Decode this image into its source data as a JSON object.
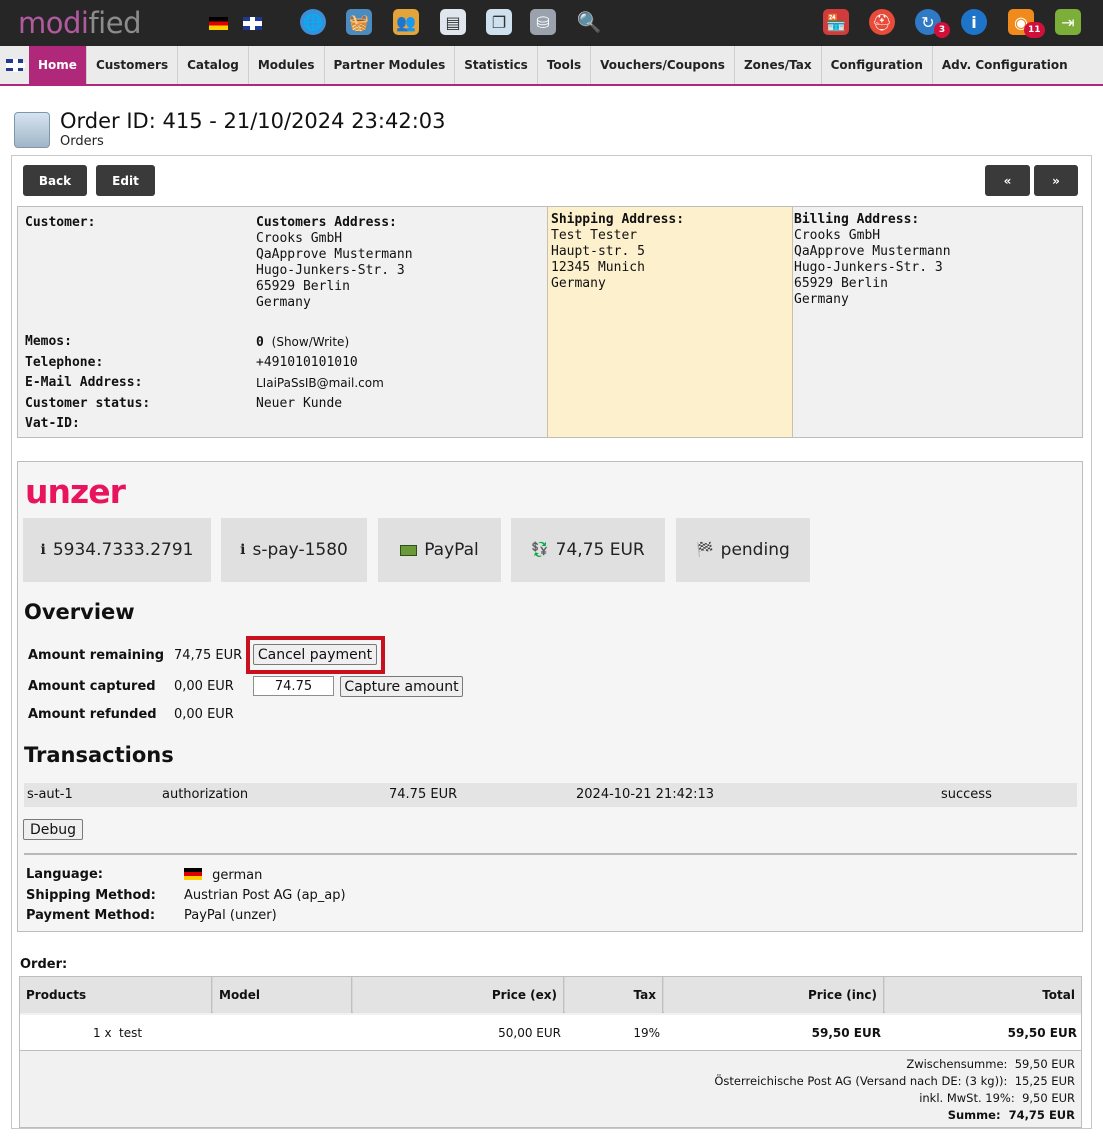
{
  "app": {
    "logo_prefix": "modi",
    "logo_suffix": "fied"
  },
  "topbar": {
    "badges": {
      "updates": "3",
      "news": "11"
    }
  },
  "nav": {
    "items": [
      "Home",
      "Customers",
      "Catalog",
      "Modules",
      "Partner Modules",
      "Statistics",
      "Tools",
      "Vouchers/Coupons",
      "Zones/Tax",
      "Configuration",
      "Adv. Configuration"
    ]
  },
  "header": {
    "title": "Order ID: 415 - 21/10/2024 23:42:03",
    "subtitle": "Orders"
  },
  "buttons": {
    "back": "Back",
    "edit": "Edit",
    "prev": "«",
    "next": "»"
  },
  "customer": {
    "customer_label": "Customer:",
    "address_label": "Customers Address:",
    "address_lines": [
      "Crooks GmbH",
      "QaApprove Mustermann",
      "Hugo-Junkers-Str. 3",
      "65929 Berlin",
      "Germany"
    ],
    "memos_label": "Memos:",
    "memos_count": "0",
    "memos_link": "(Show/Write)",
    "telephone_label": "Telephone:",
    "telephone": "+491010101010",
    "email_label": "E-Mail Address:",
    "email": "LIaiPaSsIB@mail.com",
    "status_label": "Customer status:",
    "status": "Neuer Kunde",
    "vat_label": "Vat-ID:"
  },
  "shipping": {
    "label": "Shipping Address:",
    "lines": [
      "Test Tester",
      "Haupt-str. 5",
      "12345 Munich",
      "Germany"
    ]
  },
  "billing": {
    "label": "Billing Address:",
    "lines": [
      "Crooks GmbH",
      "QaApprove Mustermann",
      "Hugo-Junkers-Str. 3",
      "65929 Berlin",
      "Germany"
    ]
  },
  "unzer": {
    "logo": "unzer",
    "tiles": [
      {
        "icon": "info-icon",
        "text": "5934.7333.2791"
      },
      {
        "icon": "info-icon",
        "text": "s-pay-1580"
      },
      {
        "icon": "payment-card-icon",
        "text": "PayPal"
      },
      {
        "icon": "money-icon",
        "text": "74,75 EUR"
      },
      {
        "icon": "flag-icon",
        "text": "pending"
      }
    ],
    "overview_title": "Overview",
    "remaining_label": "Amount remaining",
    "remaining": "74,75 EUR",
    "cancel_button": "Cancel payment",
    "captured_label": "Amount captured",
    "captured": "0,00 EUR",
    "capture_input": "74.75",
    "capture_button": "Capture amount",
    "refunded_label": "Amount refunded",
    "refunded": "0,00 EUR",
    "transactions_title": "Transactions",
    "transaction": {
      "id": "s-aut-1",
      "type": "authorization",
      "amount": "74.75 EUR",
      "date": "2024-10-21 21:42:13",
      "status": "success"
    },
    "debug_button": "Debug",
    "language_label": "Language:",
    "language": "german",
    "shipping_method_label": "Shipping Method:",
    "shipping_method": "Austrian Post AG (ap_ap)",
    "payment_method_label": "Payment Method:",
    "payment_method": "PayPal (unzer)"
  },
  "order": {
    "label": "Order:",
    "columns": [
      "Products",
      "Model",
      "Price (ex)",
      "Tax",
      "Price (inc)",
      "Total"
    ],
    "row": {
      "qty": "1 x",
      "product": "test",
      "model": "",
      "price_ex": "50,00 EUR",
      "tax": "19%",
      "price_inc": "59,50 EUR",
      "total": "59,50 EUR"
    },
    "summary": [
      {
        "label": "Zwischensumme:",
        "value": "59,50 EUR"
      },
      {
        "label": "Österreichische Post AG (Versand nach DE: (3 kg)):",
        "value": "15,25 EUR"
      },
      {
        "label": "inkl. MwSt. 19%:",
        "value": "9,50 EUR"
      },
      {
        "label": "Summe:",
        "value": "74,75 EUR"
      }
    ]
  }
}
